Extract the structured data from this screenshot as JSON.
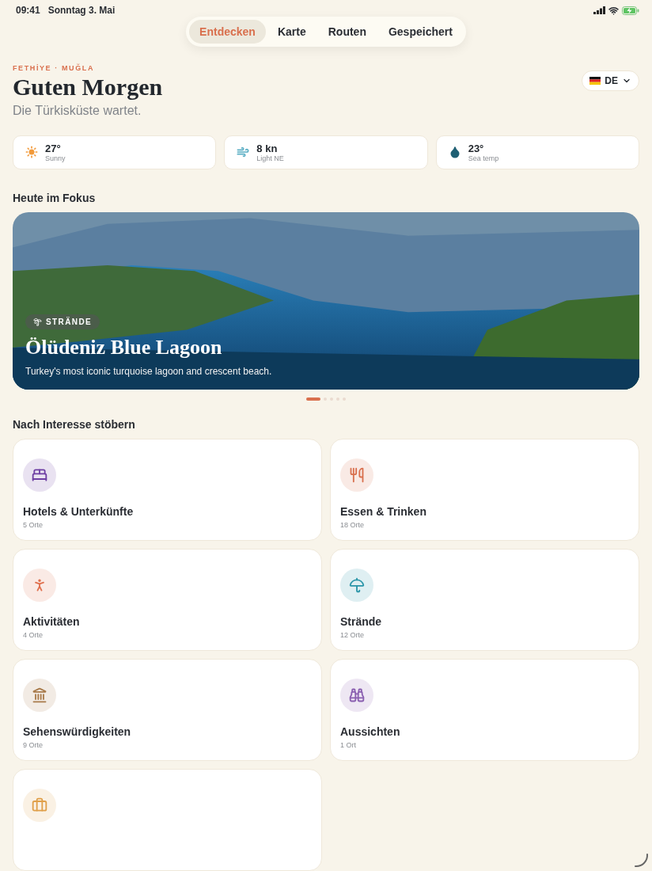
{
  "status_bar": {
    "time": "09:41",
    "date": "Sonntag 3. Mai"
  },
  "tabs": [
    {
      "label": "Entdecken",
      "selected": true
    },
    {
      "label": "Karte",
      "selected": false
    },
    {
      "label": "Routen",
      "selected": false
    },
    {
      "label": "Gespeichert",
      "selected": false
    }
  ],
  "header": {
    "location": "FETHİYE · MUĞLA",
    "greeting": "Guten Morgen",
    "subtitle": "Die Türkisküste wartet.",
    "language": "DE"
  },
  "conditions": [
    {
      "kind": "sun",
      "value": "27°",
      "label": "Sunny",
      "color": "#f29a3a"
    },
    {
      "kind": "wind",
      "value": "8 kn",
      "label": "Light NE",
      "color": "#5aaec4"
    },
    {
      "kind": "drop",
      "value": "23°",
      "label": "Sea temp",
      "color": "#1e5f73"
    }
  ],
  "featured": {
    "heading": "Heute im Fokus",
    "tag": "STRÄNDE",
    "title": "Ölüdeniz Blue Lagoon",
    "description": "Turkey's most iconic turquoise lagoon and crescent beach.",
    "dots": [
      {
        "selected": true
      },
      {
        "selected": false
      },
      {
        "selected": false
      },
      {
        "selected": false
      },
      {
        "selected": false
      }
    ]
  },
  "browse": {
    "heading": "Nach Interesse stöbern",
    "categories": [
      {
        "kind": "bed",
        "title": "Hotels & Unterkünfte",
        "count": "5 Orte",
        "color": "#6e3fa3"
      },
      {
        "kind": "cutlery",
        "title": "Essen & Trinken",
        "count": "18 Orte",
        "color": "#d9704e"
      },
      {
        "kind": "runner",
        "title": "Aktivitäten",
        "count": "4 Orte",
        "color": "#e0704e"
      },
      {
        "kind": "umbrella",
        "title": "Strände",
        "count": "12 Orte",
        "color": "#2a95a8"
      },
      {
        "kind": "landmark",
        "title": "Sehenswürdigkeiten",
        "count": "9 Orte",
        "color": "#a87a4a"
      },
      {
        "kind": "binoculars",
        "title": "Aussichten",
        "count": "1 Ort",
        "color": "#8a5fb0"
      },
      {
        "kind": "briefcase",
        "color": "#e0a04a"
      }
    ]
  }
}
